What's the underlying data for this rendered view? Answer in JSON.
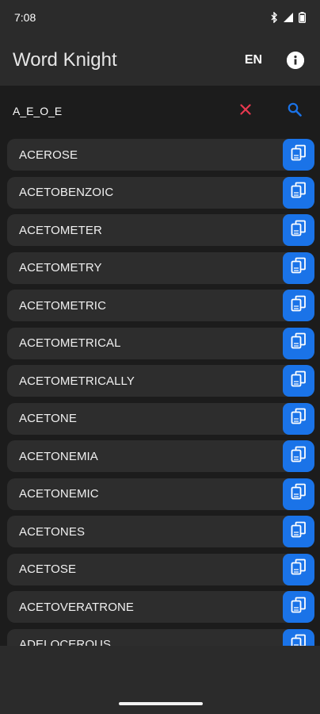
{
  "status": {
    "time": "7:08",
    "icons": [
      "bluetooth-icon",
      "signal-icon",
      "battery-icon"
    ]
  },
  "app": {
    "title": "Word Knight",
    "language": "EN",
    "info_icon": "info-icon"
  },
  "search": {
    "value": "A_E_O_E",
    "clear_icon": "close-icon",
    "search_icon": "search-icon"
  },
  "words": [
    "ACEROSE",
    "ACETOBENZOIC",
    "ACETOMETER",
    "ACETOMETRY",
    "ACETOMETRIC",
    "ACETOMETRICAL",
    "ACETOMETRICALLY",
    "ACETONE",
    "ACETONEMIA",
    "ACETONEMIC",
    "ACETONES",
    "ACETOSE",
    "ACETOVERATRONE",
    "ADELOCEROUS"
  ],
  "copy_icon": "copy-icon",
  "colors": {
    "accent": "#1a73e8",
    "clear": "#e8384f",
    "row_bg": "#2d2d2d",
    "background": "#1c1c1c",
    "bar_bg": "#2b2b2b"
  }
}
